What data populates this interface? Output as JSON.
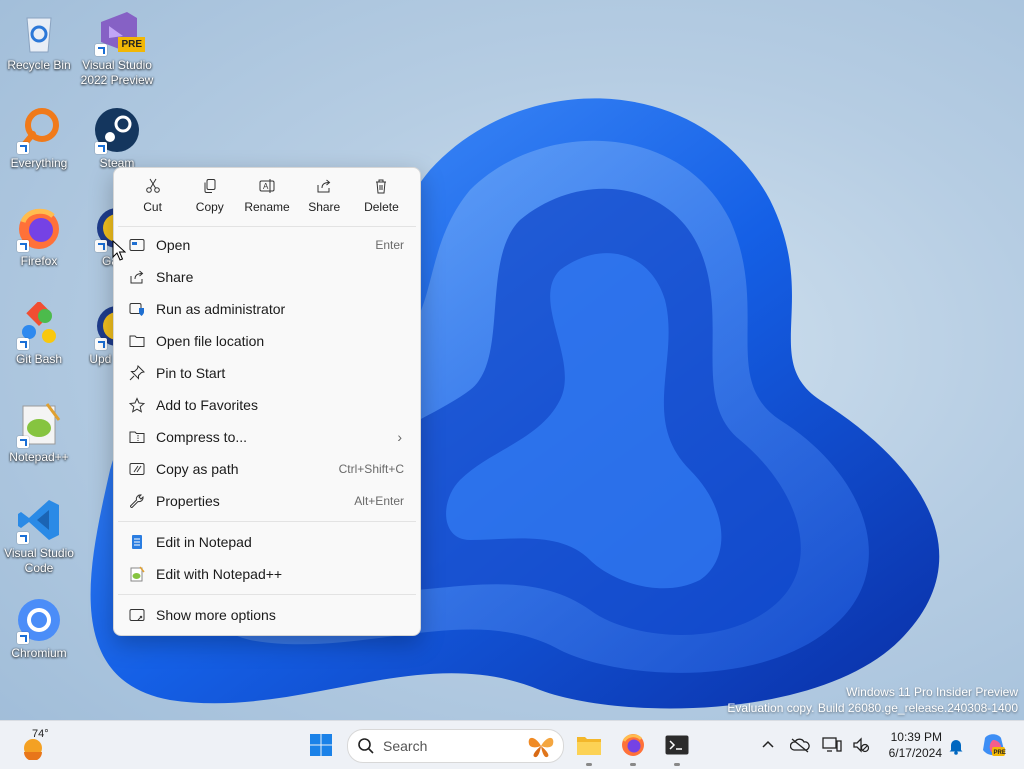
{
  "desktop": {
    "icons": [
      {
        "label": "Recycle Bin"
      },
      {
        "label": "Visual Studio 2022 Preview",
        "badge": "PRE"
      },
      {
        "label": "Everything"
      },
      {
        "label": "Steam"
      },
      {
        "label": "Firefox"
      },
      {
        "label": "Garry"
      },
      {
        "label": "Git Bash"
      },
      {
        "label": "Upd Garry"
      },
      {
        "label": "Notepad++"
      },
      {
        "label": "Visual Studio Code"
      },
      {
        "label": "Chromium"
      }
    ]
  },
  "context_menu": {
    "quick_actions": [
      {
        "label": "Cut",
        "icon": "scissors-icon"
      },
      {
        "label": "Copy",
        "icon": "copy-icon"
      },
      {
        "label": "Rename",
        "icon": "rename-icon"
      },
      {
        "label": "Share",
        "icon": "share-icon"
      },
      {
        "label": "Delete",
        "icon": "trash-icon"
      }
    ],
    "items": [
      {
        "label": "Open",
        "shortcut": "Enter",
        "icon": "open-window-icon"
      },
      {
        "label": "Share",
        "shortcut": "",
        "icon": "share-icon"
      },
      {
        "label": "Run as administrator",
        "shortcut": "",
        "icon": "shield-icon"
      },
      {
        "label": "Open file location",
        "shortcut": "",
        "icon": "folder-icon"
      },
      {
        "label": "Pin to Start",
        "shortcut": "",
        "icon": "pin-icon"
      },
      {
        "label": "Add to Favorites",
        "shortcut": "",
        "icon": "star-icon"
      },
      {
        "label": "Compress to...",
        "shortcut": "",
        "icon": "zip-icon",
        "submenu": true
      },
      {
        "label": "Copy as path",
        "shortcut": "Ctrl+Shift+C",
        "icon": "path-icon"
      },
      {
        "label": "Properties",
        "shortcut": "Alt+Enter",
        "icon": "wrench-icon"
      }
    ],
    "extra_items": [
      {
        "label": "Edit in Notepad",
        "icon": "notepad-icon"
      },
      {
        "label": "Edit with Notepad++",
        "icon": "notepadpp-icon"
      }
    ],
    "more": {
      "label": "Show more options",
      "icon": "more-options-icon"
    }
  },
  "watermark": {
    "line1": "Windows 11 Pro Insider Preview",
    "line2": "Evaluation copy. Build 26080.ge_release.240308-1400"
  },
  "taskbar": {
    "weather": "74°",
    "search_placeholder": "Search",
    "clock_time": "10:39 PM",
    "clock_date": "6/17/2024",
    "accent": "#0067c0"
  }
}
